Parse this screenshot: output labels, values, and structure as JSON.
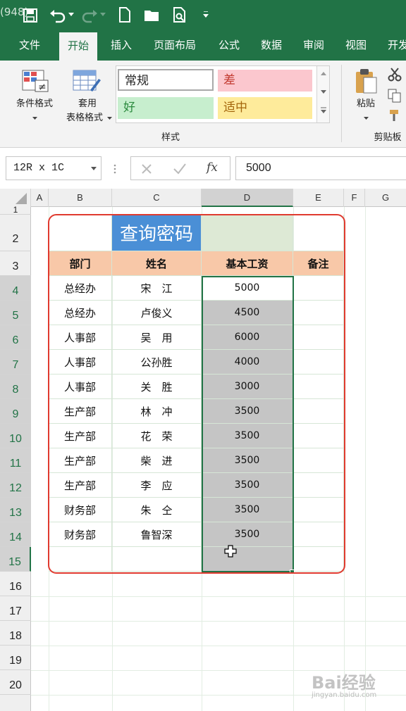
{
  "titlebar": {
    "doc_title": "(948)"
  },
  "tabs": [
    "文件",
    "开始",
    "插入",
    "页面布局",
    "公式",
    "数据",
    "审阅",
    "视图",
    "开发"
  ],
  "ribbon": {
    "conditional_format": "条件格式",
    "table_format_line1": "套用",
    "table_format_line2": "表格格式",
    "styles": {
      "normal": "常规",
      "bad": "差",
      "good": "好",
      "neutral": "适中"
    },
    "styles_group": "样式",
    "paste": "粘贴",
    "clipboard_group": "剪贴板"
  },
  "formula_bar": {
    "name_box": "12R x 1C",
    "fx": "fx",
    "value": "5000"
  },
  "columns": [
    "A",
    "B",
    "C",
    "D",
    "E",
    "F",
    "G"
  ],
  "rows": [
    "1",
    "2",
    "3",
    "4",
    "5",
    "6",
    "7",
    "8",
    "9",
    "10",
    "11",
    "12",
    "13",
    "14",
    "15",
    "16",
    "17",
    "18",
    "19",
    "20"
  ],
  "sheet": {
    "title": "查询密码",
    "headers": [
      "部门",
      "姓名",
      "基本工资",
      "备注"
    ],
    "records": [
      {
        "dept": "总经办",
        "name": "宋　江",
        "salary": "5000"
      },
      {
        "dept": "总经办",
        "name": "卢俊义",
        "salary": "4500"
      },
      {
        "dept": "人事部",
        "name": "吴　用",
        "salary": "6000"
      },
      {
        "dept": "人事部",
        "name": "公孙胜",
        "salary": "4000"
      },
      {
        "dept": "人事部",
        "name": "关　胜",
        "salary": "3000"
      },
      {
        "dept": "生产部",
        "name": "林　冲",
        "salary": "3500"
      },
      {
        "dept": "生产部",
        "name": "花　荣",
        "salary": "3500"
      },
      {
        "dept": "生产部",
        "name": "柴　进",
        "salary": "3500"
      },
      {
        "dept": "生产部",
        "name": "李　应",
        "salary": "3500"
      },
      {
        "dept": "财务部",
        "name": "朱　仝",
        "salary": "3500"
      },
      {
        "dept": "财务部",
        "name": "鲁智深",
        "salary": "3500"
      }
    ]
  },
  "watermark": {
    "line1": "Bai经验",
    "line2": "jingyan.baidu.com"
  },
  "colors": {
    "excel_green": "#217346",
    "header_fill": "#f8c8a8",
    "title_fill": "#4a8fd6",
    "selection_fill": "#c5c5c5",
    "annotation_red": "#e03a2f"
  }
}
